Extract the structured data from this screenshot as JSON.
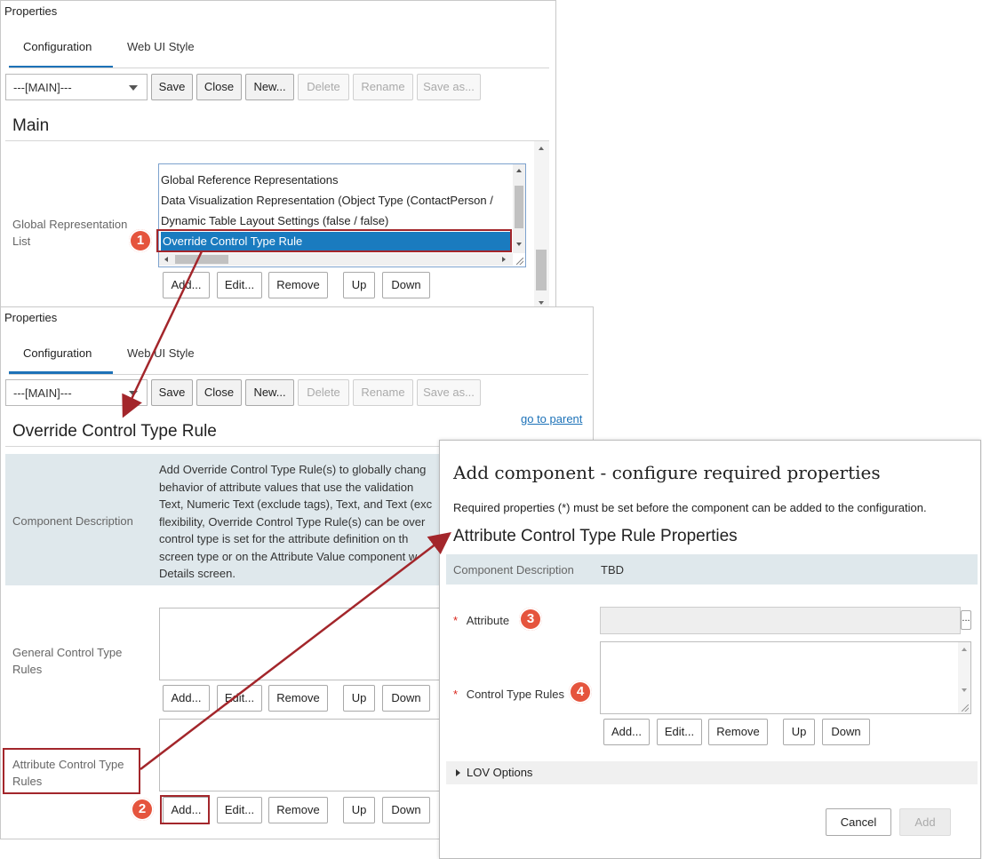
{
  "panel1": {
    "title": "Properties",
    "tabs": [
      "Configuration",
      "Web UI Style"
    ],
    "select_value": "---[MAIN]---",
    "toolbar": [
      "Save",
      "Close",
      "New...",
      "Delete",
      "Rename",
      "Save as..."
    ],
    "heading": "Main",
    "field_label": "Global Representation List",
    "list_items": [
      "Global Reference Representations",
      "Data Visualization Representation (Object Type (ContactPerson /",
      "Dynamic Table Layout Settings (false / false)",
      "Override Control Type Rule"
    ],
    "list_buttons": [
      "Add...",
      "Edit...",
      "Remove",
      "Up",
      "Down"
    ]
  },
  "panel2": {
    "title": "Properties",
    "tabs": [
      "Configuration",
      "Web UI Style"
    ],
    "select_value": "---[MAIN]---",
    "toolbar": [
      "Save",
      "Close",
      "New...",
      "Delete",
      "Rename",
      "Save as..."
    ],
    "go_to_parent": "go to parent",
    "heading": "Override Control Type Rule",
    "desc_label": "Component Description",
    "desc_lines": [
      "Add Override Control Type Rule(s) to globally chang",
      "behavior of attribute values that use the validation",
      "Text, Numeric Text (exclude tags), Text, and Text (exc",
      "flexibility, Override Control Type Rule(s) can be over",
      "control type is set for the attribute definition on th",
      "screen type or on the Attribute Value component w",
      "Details screen."
    ],
    "general_label": "General Control Type Rules",
    "attr_label": "Attribute Control Type Rules",
    "buttons": [
      "Add...",
      "Edit...",
      "Remove",
      "Up",
      "Down"
    ]
  },
  "dialog": {
    "title": "Add component - configure required properties",
    "note": "Required properties (*) must be set before the component can be added to the configuration.",
    "section": "Attribute Control Type Rule Properties",
    "desc_label": "Component Description",
    "desc_value": "TBD",
    "required_mark": "*",
    "attribute_label": "Attribute",
    "browse_label": "...",
    "rules_label": "Control Type Rules",
    "buttons": [
      "Add...",
      "Edit...",
      "Remove",
      "Up",
      "Down"
    ],
    "lov": "LOV Options",
    "cancel": "Cancel",
    "add": "Add"
  },
  "callouts": [
    "1",
    "2",
    "3",
    "4"
  ],
  "colors": {
    "accent": "#1d72b8",
    "selection": "#1a7bbf",
    "callout": "#e5543d",
    "highlight": "#a3262b"
  }
}
